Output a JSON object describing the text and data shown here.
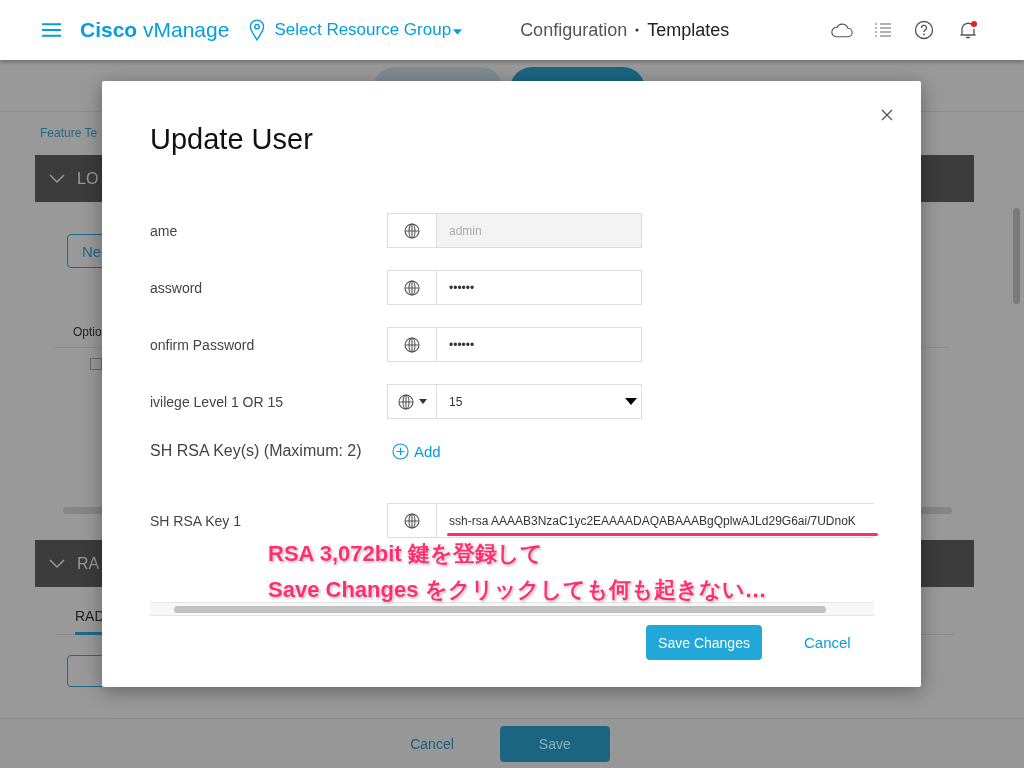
{
  "header": {
    "logo": "**Cisco** vManage",
    "resource_group": "Select Resource Group",
    "breadcrumb": [
      "Configuration",
      "Templates"
    ],
    "notification_unread": true
  },
  "background": {
    "breadcrumb": "Feature Te",
    "sections": [
      {
        "title": "LO",
        "expanded": true
      },
      {
        "title": "RA",
        "expanded": true
      }
    ],
    "new_button": "Ne",
    "column_header": "Optio",
    "checkbox_checked": false,
    "tab": "RAD"
  },
  "footer": {
    "cancel": "Cancel",
    "save": "Save"
  },
  "dialog": {
    "title": "Update User",
    "fields": [
      {
        "kind": "text",
        "label": "ame",
        "value": "admin",
        "disabled": true
      },
      {
        "kind": "text",
        "label": "assword",
        "value": "••••••",
        "disabled": false
      },
      {
        "kind": "text",
        "label": "onfirm Password",
        "value": "••••••",
        "disabled": false
      },
      {
        "kind": "select",
        "label": "ivilege Level 1 OR 15",
        "value": "15"
      },
      {
        "kind": "add",
        "label": "SH RSA Key(s) (Maximum: 2)",
        "action": "Add"
      },
      {
        "kind": "wide",
        "label": "SH RSA Key 1",
        "value": "ssh-rsa AAAAB3NzaC1yc2EAAAADAQABAAABgQplwAJLd29G6ai/7UDnoK",
        "disabled": false
      }
    ],
    "save": "Save Changes",
    "cancel": "Cancel"
  },
  "annotation": {
    "lines": [
      "RSA 3,072bit 鍵を登録して",
      "Save Changes をクリックしても何も起きない…"
    ]
  }
}
